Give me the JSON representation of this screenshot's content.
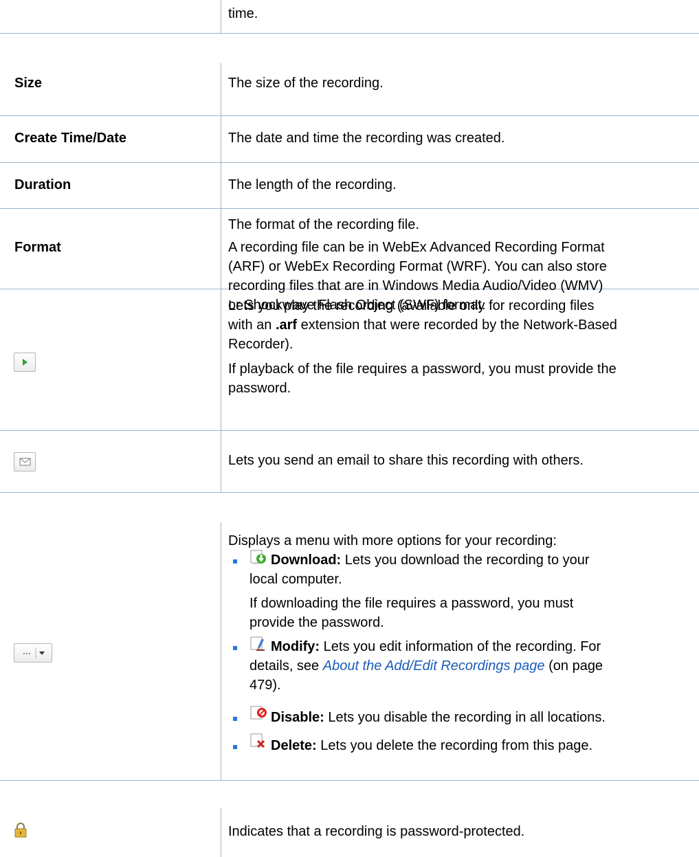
{
  "top": {
    "text": "time."
  },
  "rows": {
    "size": {
      "label": "Size",
      "desc": "The size of the recording."
    },
    "create": {
      "label": "Create Time/Date",
      "desc": "The date and time the recording was created."
    },
    "duration": {
      "label": "Duration",
      "desc": "The length of the recording."
    },
    "format": {
      "label": "Format",
      "desc1": "The format of the recording file.",
      "desc2_l1": "A recording file can be in WebEx Advanced Recording Format",
      "desc2_l2": "(ARF) or WebEx Recording Format (WRF). You can also store",
      "desc2_l3": "recording files that are in Windows Media Audio/Video (WMV)",
      "desc2_l4": "or Shockwave Flash Object (SWF) format."
    },
    "play": {
      "l1": "Lets you play the recording (available only for recording files",
      "l2_pre": "with an ",
      "l2_bold": ".arf",
      "l2_post": " extension that were recorded by the Network-Based",
      "l3": "Recorder).",
      "l4": "If playback of the file requires a password, you must provide the",
      "l5": "password."
    },
    "email": {
      "desc": "Lets you send an email to share this recording with others."
    },
    "more": {
      "intro": "Displays a menu with more options for your recording:",
      "download_title": "Download:",
      "download_l1": " Lets you download the recording to your",
      "download_l2": "local computer.",
      "download_note_l1": "If downloading the file requires a password, you must",
      "download_note_l2": "provide the password.",
      "modify_title": "Modify:",
      "modify_l1": " Lets you edit information of the recording. For",
      "modify_l2_pre": "details, see ",
      "modify_link": "About the Add/Edit Recordings page",
      "modify_l2_post": " (on page",
      "modify_l3": "479).",
      "disable_title": "Disable:",
      "disable_desc": " Lets you disable the recording in all locations.",
      "delete_title": "Delete:",
      "delete_desc": " Lets you delete the recording from this page."
    },
    "lock": {
      "desc": "Indicates that a recording is password-protected."
    }
  },
  "icons": {
    "play": "play-icon",
    "email": "envelope-icon",
    "more": "more-options-dropdown-icon",
    "download": "download-icon",
    "modify": "modify-icon",
    "disable": "disable-icon",
    "delete": "delete-icon",
    "lock": "lock-icon"
  },
  "colors": {
    "rule": "#9db2c8",
    "link": "#1a5cb8",
    "bullet": "#2a78d6",
    "play_green": "#2ea02e"
  }
}
